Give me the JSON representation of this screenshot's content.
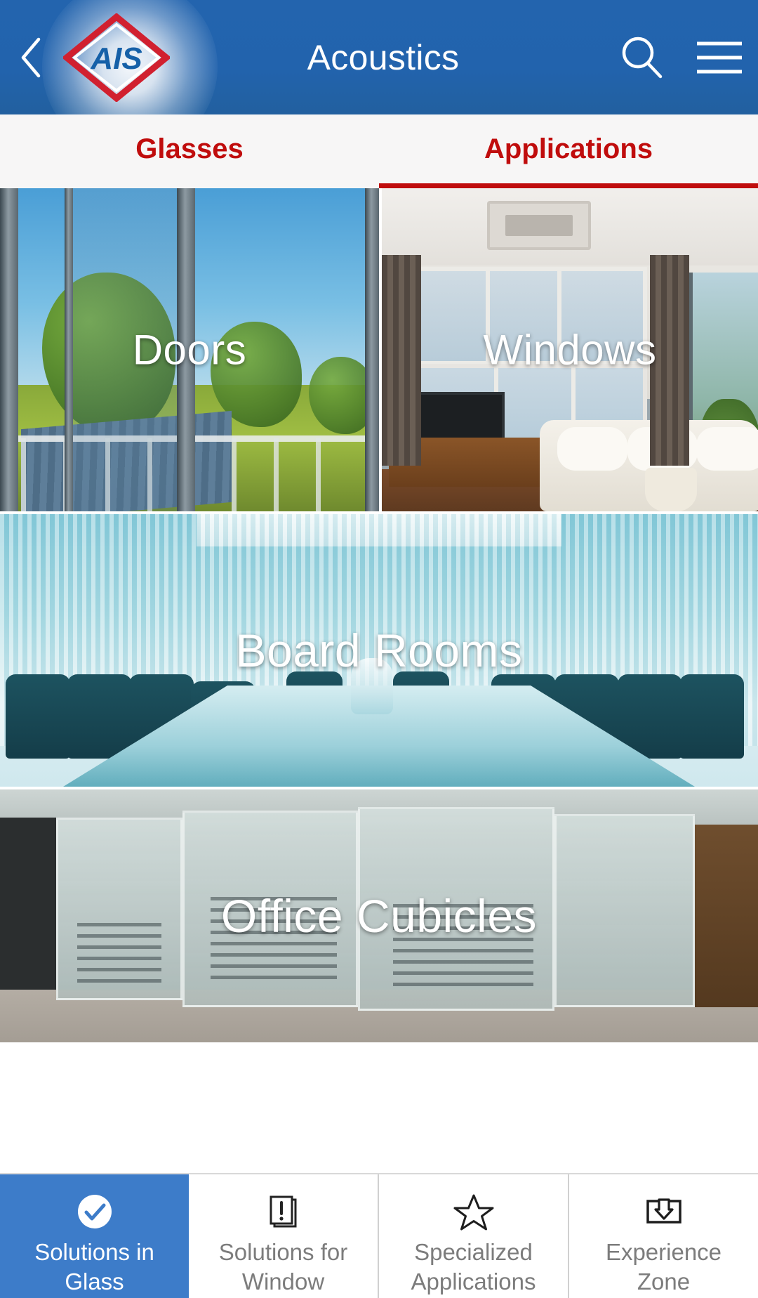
{
  "header": {
    "back_icon": "chevron-left-icon",
    "logo_text": "AIS",
    "title": "Acoustics",
    "search_icon": "search-icon",
    "menu_icon": "hamburger-menu-icon",
    "bg_color": "#2263ad",
    "logo_diamond_color": "#d1202f",
    "logo_text_color": "#1560a8"
  },
  "tabs": {
    "active_color": "#c00d0d",
    "items": [
      {
        "label": "Glasses",
        "active": false
      },
      {
        "label": "Applications",
        "active": true
      }
    ]
  },
  "grid": {
    "tiles": [
      {
        "label": "Doors"
      },
      {
        "label": "Windows"
      },
      {
        "label": "Board Rooms"
      },
      {
        "label": "Office Cubicles"
      }
    ]
  },
  "bottom_nav": {
    "active_bg": "#3d7cc9",
    "inactive_text": "#7c7c7c",
    "items": [
      {
        "label": "Solutions in\nGlass",
        "icon": "check-circle-icon",
        "active": true
      },
      {
        "label": "Solutions for\nWindow",
        "icon": "document-alert-icon",
        "active": false
      },
      {
        "label": "Specialized\nApplications",
        "icon": "star-outline-icon",
        "active": false
      },
      {
        "label": "Experience\nZone",
        "icon": "inbox-download-icon",
        "active": false
      }
    ]
  }
}
